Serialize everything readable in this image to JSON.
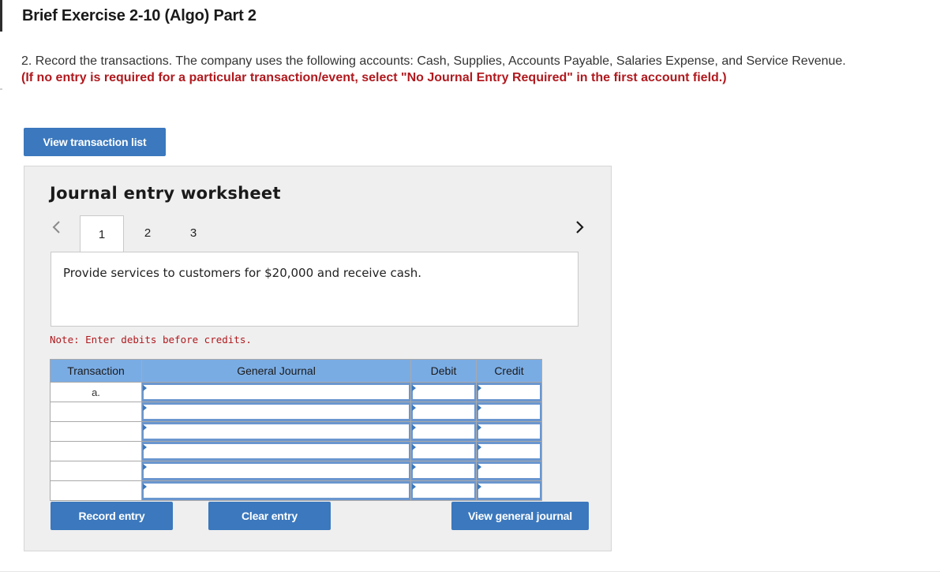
{
  "header": {
    "title": "Brief Exercise 2-10 (Algo) Part 2"
  },
  "instructions": {
    "text": "2. Record the transactions. The company uses the following accounts: Cash, Supplies, Accounts Payable, Salaries Expense, and Service Revenue.",
    "emphasis": "(If no entry is required for a particular transaction/event, select \"No Journal Entry Required\" in the first account field.)"
  },
  "buttons": {
    "view_transaction_list": "View transaction list",
    "record_entry": "Record entry",
    "clear_entry": "Clear entry",
    "view_general_journal": "View general journal"
  },
  "worksheet": {
    "title": "Journal entry worksheet",
    "tabs": [
      "1",
      "2",
      "3"
    ],
    "active_tab": "1",
    "description": "Provide services to customers for $20,000 and receive cash.",
    "note": "Note: Enter debits before credits."
  },
  "journal_table": {
    "headers": {
      "transaction": "Transaction",
      "general_journal": "General Journal",
      "debit": "Debit",
      "credit": "Credit"
    },
    "rows": [
      {
        "transaction": "a.",
        "account": "",
        "debit": "",
        "credit": ""
      },
      {
        "transaction": "",
        "account": "",
        "debit": "",
        "credit": ""
      },
      {
        "transaction": "",
        "account": "",
        "debit": "",
        "credit": ""
      },
      {
        "transaction": "",
        "account": "",
        "debit": "",
        "credit": ""
      },
      {
        "transaction": "",
        "account": "",
        "debit": "",
        "credit": ""
      },
      {
        "transaction": "",
        "account": "",
        "debit": "",
        "credit": ""
      }
    ]
  },
  "icons": {
    "prev": "chevron-left-icon",
    "next": "chevron-right-icon"
  },
  "colors": {
    "accent": "#3b78bd",
    "header_blue": "#7aace4",
    "emphasis_red": "#b0191e"
  }
}
